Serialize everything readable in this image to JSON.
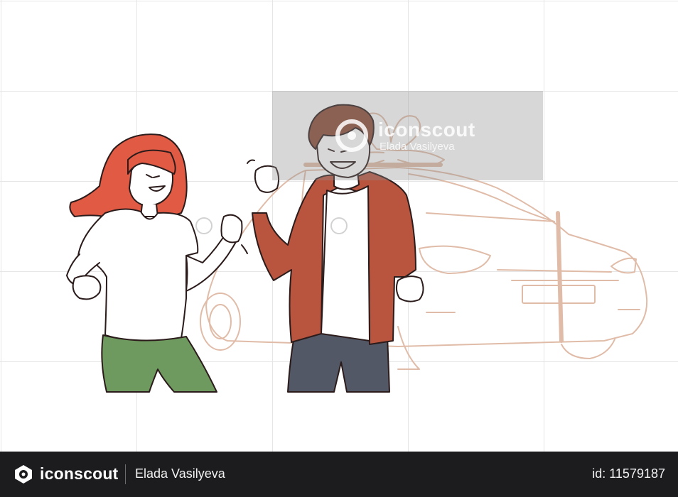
{
  "watermark": {
    "brand": "iconscout",
    "author": "Elada Vasilyeva"
  },
  "illustration": {
    "subjects": [
      "woman",
      "man",
      "car"
    ],
    "colors": {
      "woman_hair": "#e05a44",
      "woman_pants": "#6f9a5f",
      "man_jacket": "#b9553e",
      "man_hair": "#8a4a35",
      "man_pants": "#535866",
      "skin": "#ffffff",
      "outline": "#2b1b1b",
      "car_line": "#e0bca8"
    }
  },
  "footer": {
    "brand": "iconscout",
    "author": "Elada Vasilyeva",
    "asset_id": "id: 11579187"
  }
}
